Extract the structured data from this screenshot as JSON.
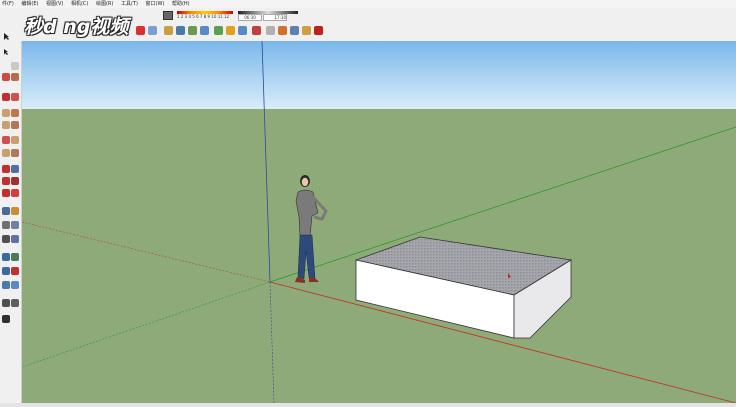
{
  "menu": {
    "items": [
      "件(F)",
      "编辑(E)",
      "视图(V)",
      "相机(C)",
      "绘图(R)",
      "工具(T)",
      "窗口(W)",
      "帮助(H)"
    ]
  },
  "logo": {
    "text": "秒d ng视频"
  },
  "shadow_settings": {
    "months": "1 2 3 4 5 6 7 8 9 10 11 12",
    "time_start": "06:30",
    "time_mid": "中午",
    "time_end": "17:30"
  },
  "status": {
    "text": ""
  },
  "colors": {
    "sky_top": "#7ab7ea",
    "sky_bottom": "#d9edf9",
    "ground": "#8faa79",
    "box_top": "#9a9aa2",
    "box_side": "#ffffff"
  },
  "top_icons": [
    "select-icon",
    "logo-area",
    "orbit-icon",
    "pan-icon",
    "zoom-icon",
    "eraser-icon",
    "paint-icon",
    "line-icon",
    "arc-icon",
    "rect-icon",
    "circle-icon",
    "push-pull-icon",
    "move-icon",
    "rotate-icon",
    "scale-icon",
    "tape-icon",
    "text-icon",
    "axes-icon",
    "section-icon",
    "walk-icon",
    "look-icon",
    "sandbox-icon",
    "component-icon",
    "ruby-icon"
  ],
  "left_icons": [
    "select-icon",
    "component-icon",
    "eraser-icon",
    "paint-icon",
    "line-icon",
    "freehand-icon",
    "rect-icon",
    "rotated-rect-icon",
    "circle-icon",
    "polygon-icon",
    "arc-icon",
    "pie-icon",
    "move-icon",
    "push-pull-icon",
    "rotate-icon",
    "follow-me-icon",
    "scale-icon",
    "offset-icon",
    "tape-icon",
    "dimension-icon",
    "protractor-icon",
    "text-icon",
    "axes-icon",
    "3d-text-icon",
    "orbit-icon",
    "pan-icon",
    "zoom-icon",
    "zoom-window-icon",
    "zoom-extents-icon",
    "previous-view-icon",
    "position-camera-icon",
    "walk-icon",
    "look-around-icon",
    "section-plane-icon"
  ]
}
